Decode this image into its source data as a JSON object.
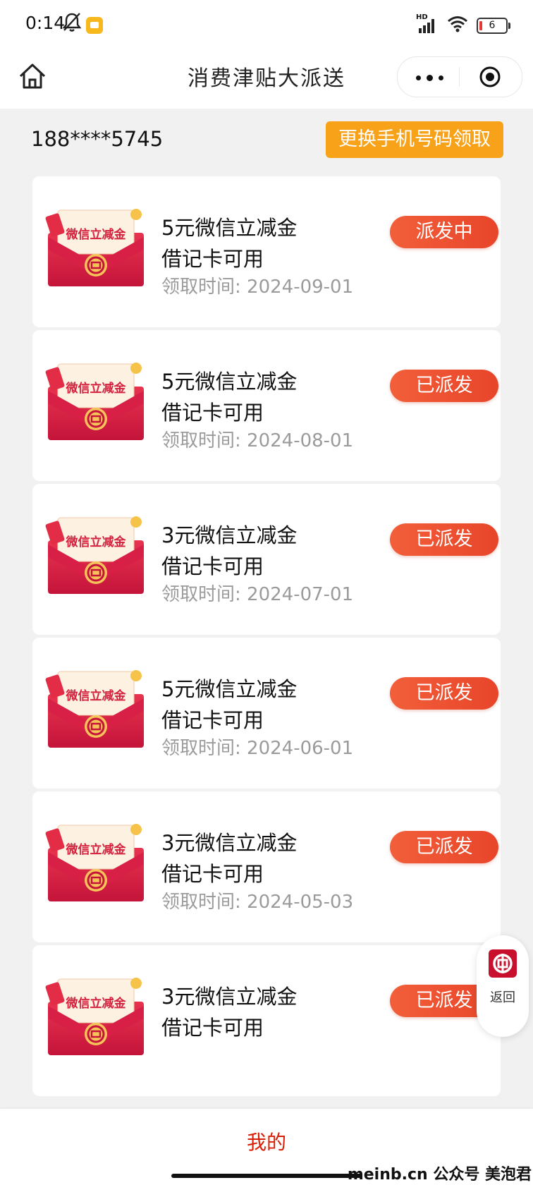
{
  "status_bar": {
    "time": "0:14",
    "network_label": "HD",
    "battery": "6",
    "icons": [
      "bell-off-icon",
      "app-notification-icon",
      "signal-icon",
      "wifi-icon",
      "battery-icon"
    ]
  },
  "nav": {
    "title": "消费津贴大派送",
    "icons": [
      "home-icon",
      "more-icon",
      "close-target-icon"
    ]
  },
  "account": {
    "phone": "188****5745",
    "change_button": "更换手机号码领取"
  },
  "coupons": [
    {
      "title": "5元微信立减金",
      "subtitle": "借记卡可用",
      "time": "领取时间: 2024-09-01",
      "status": "派发中",
      "envelope_text": "微信立减金"
    },
    {
      "title": "5元微信立减金",
      "subtitle": "借记卡可用",
      "time": "领取时间: 2024-08-01",
      "status": "已派发",
      "envelope_text": "微信立减金"
    },
    {
      "title": "3元微信立减金",
      "subtitle": "借记卡可用",
      "time": "领取时间: 2024-07-01",
      "status": "已派发",
      "envelope_text": "微信立减金"
    },
    {
      "title": "5元微信立减金",
      "subtitle": "借记卡可用",
      "time": "领取时间: 2024-06-01",
      "status": "已派发",
      "envelope_text": "微信立减金"
    },
    {
      "title": "3元微信立减金",
      "subtitle": "借记卡可用",
      "time": "领取时间: 2024-05-03",
      "status": "已派发",
      "envelope_text": "微信立减金"
    },
    {
      "title": "3元微信立减金",
      "subtitle": "借记卡可用",
      "time": "",
      "status": "已派发",
      "envelope_text": "微信立减金"
    }
  ],
  "float_button": {
    "label": "返回",
    "icon": "bank-logo-icon"
  },
  "bottom_tab": {
    "label": "我的"
  },
  "watermark": "meinb.cn 公众号 美泡君",
  "colors": {
    "accent_orange": "#f8a21a",
    "status_red": "#e8452a",
    "tab_red": "#d81e06",
    "muted_text": "#9b9b9b"
  }
}
